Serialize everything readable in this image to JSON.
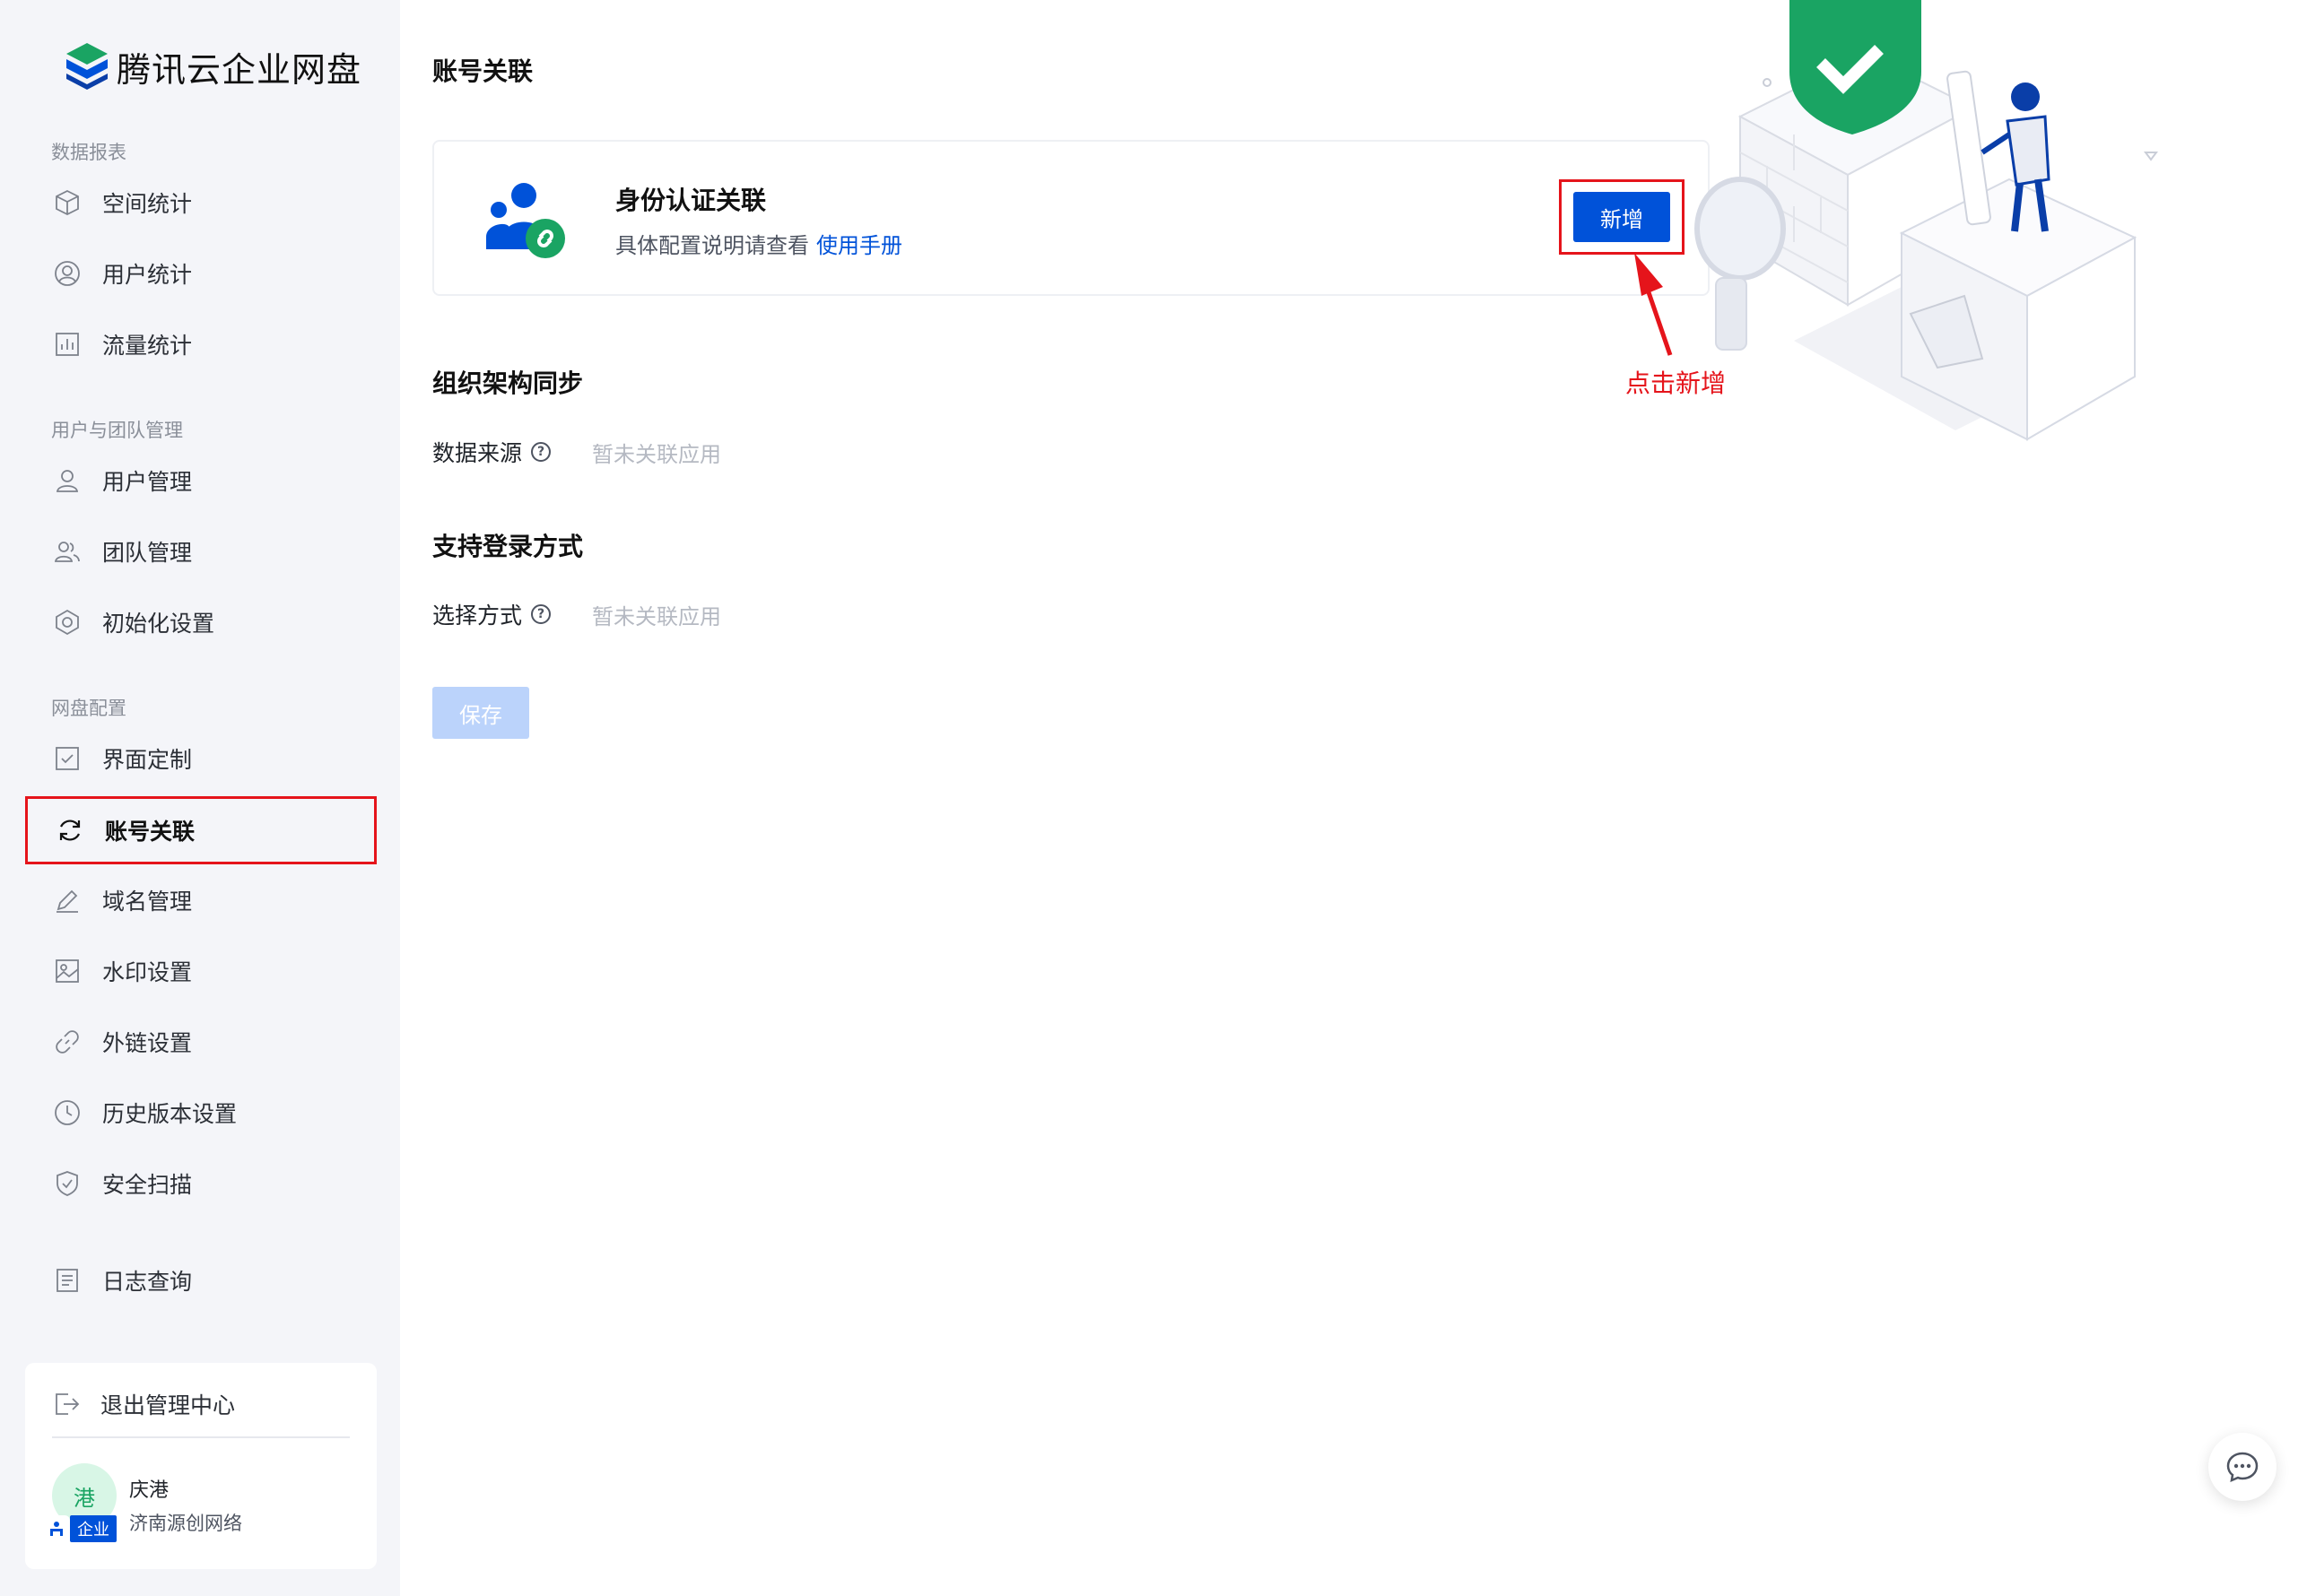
{
  "app": {
    "brand_name": "腾讯云企业网盘"
  },
  "sidebar": {
    "sections": [
      {
        "title": "数据报表",
        "items": [
          {
            "label": "空间统计",
            "icon": "cube-icon"
          },
          {
            "label": "用户统计",
            "icon": "user-circle-icon"
          },
          {
            "label": "流量统计",
            "icon": "bar-chart-icon"
          }
        ]
      },
      {
        "title": "用户与团队管理",
        "items": [
          {
            "label": "用户管理",
            "icon": "user-icon"
          },
          {
            "label": "团队管理",
            "icon": "team-icon"
          },
          {
            "label": "初始化设置",
            "icon": "hexagon-settings-icon"
          }
        ]
      },
      {
        "title": "网盘配置",
        "items": [
          {
            "label": "界面定制",
            "icon": "check-square-icon"
          },
          {
            "label": "账号关联",
            "icon": "sync-icon",
            "active": true
          },
          {
            "label": "域名管理",
            "icon": "edit-icon"
          },
          {
            "label": "水印设置",
            "icon": "image-icon"
          },
          {
            "label": "外链设置",
            "icon": "link-icon"
          },
          {
            "label": "历史版本设置",
            "icon": "clock-icon"
          },
          {
            "label": "安全扫描",
            "icon": "shield-check-icon"
          }
        ]
      }
    ],
    "log_item": {
      "label": "日志查询",
      "icon": "document-list-icon"
    },
    "bottom": {
      "exit_label": "退出管理中心",
      "avatar_text": "港",
      "enterprise_tag": "企业",
      "user_name": "庆港",
      "org_name": "济南源创网络"
    }
  },
  "main": {
    "page_title": "账号关联",
    "identity_card": {
      "title": "身份认证关联",
      "description": "具体配置说明请查看",
      "manual_link": "使用手册",
      "add_button": "新增"
    },
    "annotation": {
      "text": "点击新增",
      "color": "#e5141b"
    },
    "org_sync": {
      "title": "组织架构同步",
      "field_label": "数据来源",
      "field_value": "暂未关联应用"
    },
    "login_methods": {
      "title": "支持登录方式",
      "field_label": "选择方式",
      "field_value": "暂未关联应用"
    },
    "save_button": "保存"
  },
  "colors": {
    "primary": "#0052d9",
    "sidebar_bg": "#f4f5f9",
    "highlight_red": "#e5141b",
    "disabled_button": "#bbd3fb",
    "placeholder": "#b5b9c2"
  }
}
